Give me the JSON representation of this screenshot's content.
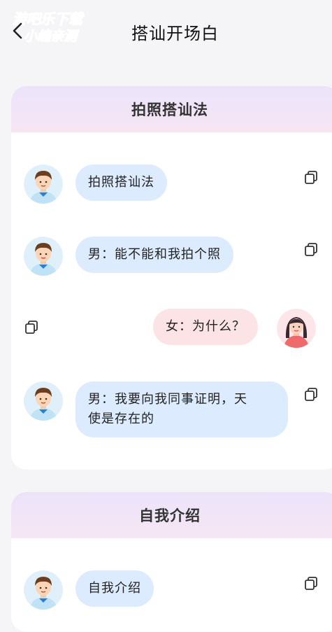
{
  "header": {
    "title": "搭讪开场白",
    "watermark_line1": "游吧乐下载",
    "watermark_line2": "小编亲测"
  },
  "sections": [
    {
      "title": "拍照搭讪法",
      "messages": [
        {
          "side": "left",
          "speaker": "male",
          "text": "拍照搭讪法"
        },
        {
          "side": "left",
          "speaker": "male",
          "text": "男：能不能和我拍个照"
        },
        {
          "side": "right",
          "speaker": "female",
          "text": "女：为什么？"
        },
        {
          "side": "left",
          "speaker": "male",
          "text_line1": "男：我要向我同事证明，天",
          "text_line2": "使是存在的"
        }
      ]
    },
    {
      "title": "自我介绍",
      "messages": [
        {
          "side": "left",
          "speaker": "male",
          "text": "自我介绍"
        }
      ]
    }
  ],
  "colors": {
    "male_bubble": "#dcebfd",
    "female_bubble": "#fbe3e6",
    "header_gradient_start": "#ece3fb",
    "header_gradient_end": "#f6e6f3",
    "watermark": "#1ec8e8"
  },
  "icons": [
    "chevron-left-icon",
    "copy-icon",
    "male-avatar",
    "female-avatar"
  ]
}
